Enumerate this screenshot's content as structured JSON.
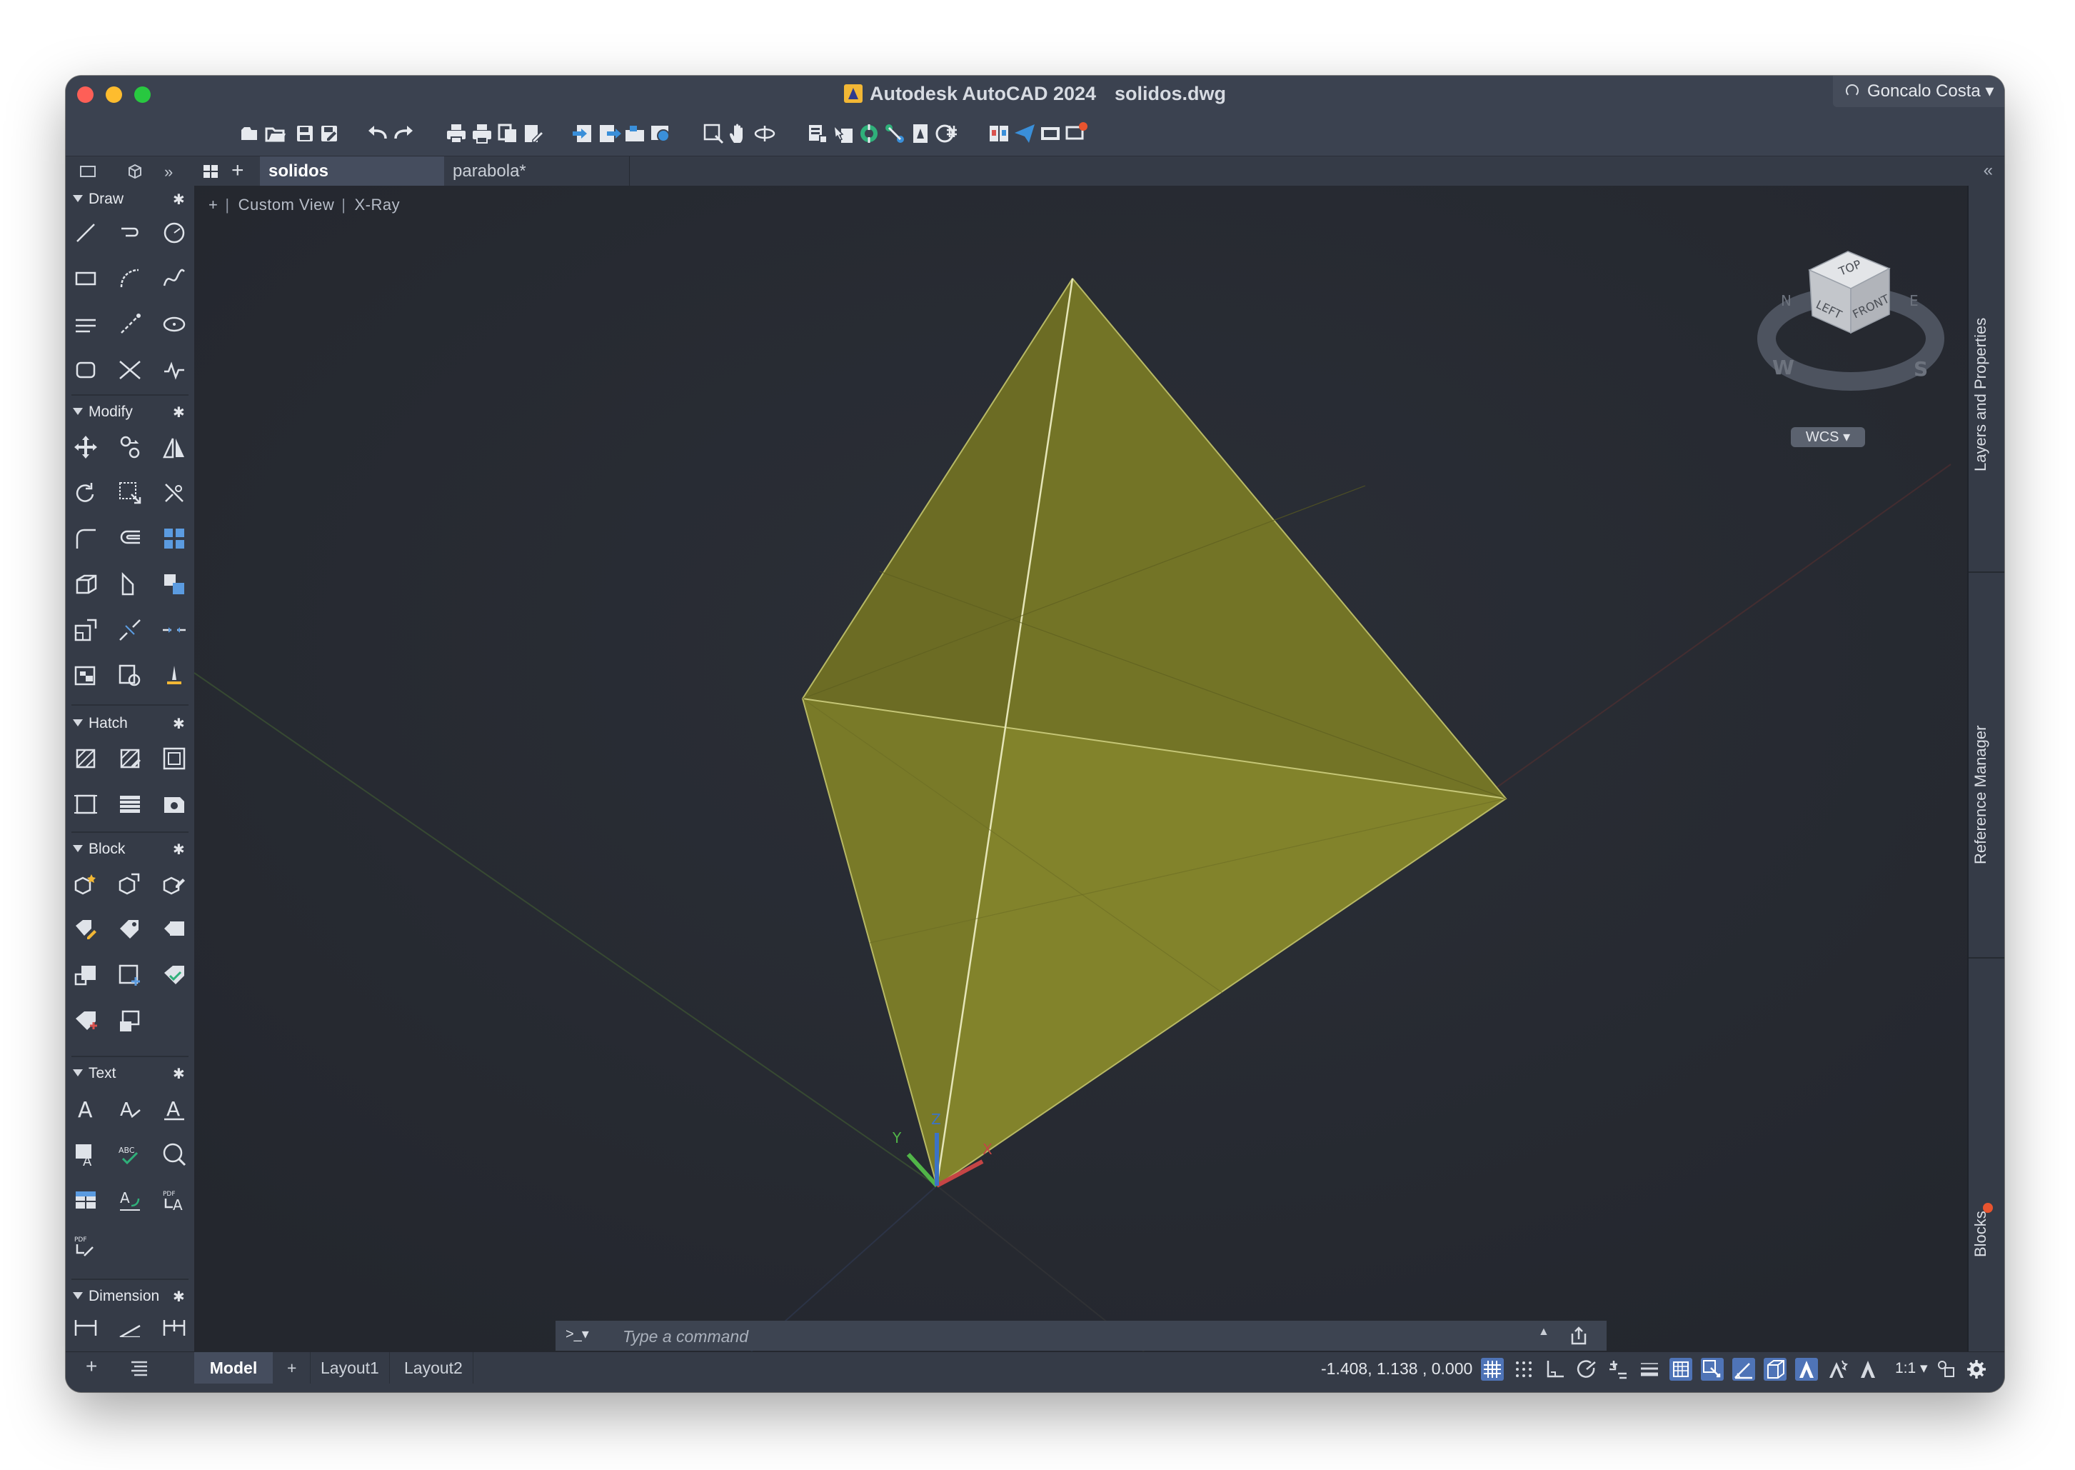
{
  "window": {
    "app_title": "Autodesk AutoCAD 2024",
    "file_title": "solidos.dwg",
    "user_name": "Goncalo Costa"
  },
  "toolbar": {
    "items": [
      "new-icon",
      "open-icon",
      "save-icon",
      "save-as-icon",
      "undo-icon",
      "redo-icon",
      "plot-icon",
      "batch-plot-icon",
      "plot-preview-icon",
      "publish-icon",
      "import-icon",
      "export-icon",
      "share-view-icon",
      "web-mobile-icon",
      "zoom-window-icon",
      "pan-icon",
      "orbit-icon",
      "layer-properties-icon",
      "match-properties-icon",
      "xref-icon",
      "insert-block-icon",
      "attach-image-icon",
      "data-extraction-icon",
      "compare-icon",
      "send-icon",
      "sheet-set-icon",
      "notifications-icon"
    ]
  },
  "tabs": {
    "active": "solidos",
    "inactive": "parabola*"
  },
  "viewport": {
    "plus": "+",
    "view_name": "Custom View",
    "visual_style": "X-Ray",
    "viewcube": {
      "top": "TOP",
      "left": "LEFT",
      "front": "FRONT",
      "wcs": "WCS",
      "compass_w": "W",
      "compass_s": "S",
      "compass_n": "N",
      "compass_e": "E"
    },
    "ucs": {
      "x": "X",
      "y": "Y",
      "z": "Z"
    }
  },
  "palette": {
    "sections": [
      {
        "name": "Draw"
      },
      {
        "name": "Modify"
      },
      {
        "name": "Hatch"
      },
      {
        "name": "Block"
      },
      {
        "name": "Text"
      },
      {
        "name": "Dimension"
      }
    ]
  },
  "right_panels": {
    "layers": "Layers and Properties",
    "reference": "Reference Manager",
    "blocks": "Blocks"
  },
  "command": {
    "prompt": ">_▾",
    "placeholder": "Type a command"
  },
  "statusbar": {
    "model": "Model",
    "plus": "+",
    "layout1": "Layout1",
    "layout2": "Layout2",
    "coordinates": "-1.408, 1.138 , 0.000",
    "scale": "1:1 ▾"
  },
  "colors": {
    "solid_face_light": "#8f902f",
    "solid_face_dark": "#6a6a23",
    "viewport_bg": "#262a31",
    "chrome": "#3b4250",
    "accent_toggle": "#4f74b7"
  }
}
